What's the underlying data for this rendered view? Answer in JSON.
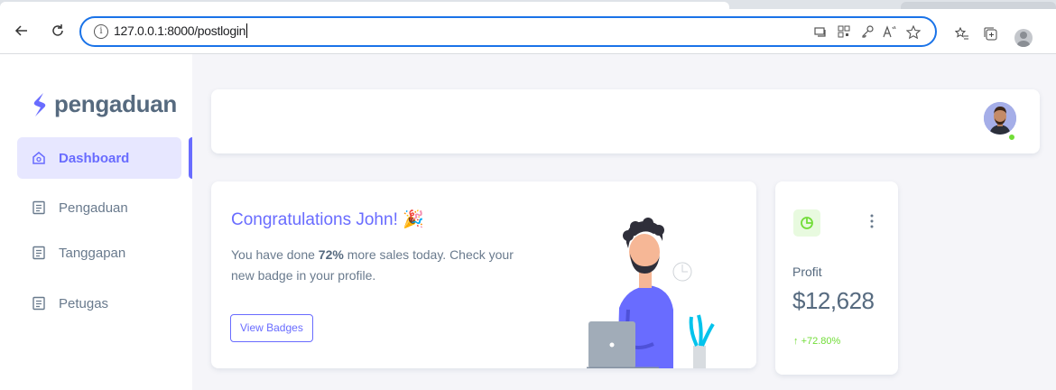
{
  "browser": {
    "url": "127.0.0.1:8000/postlogin"
  },
  "sidebar": {
    "brand": "pengaduan",
    "items": [
      {
        "label": "Dashboard",
        "active": true
      },
      {
        "label": "Pengaduan",
        "active": false
      },
      {
        "label": "Tanggapan",
        "active": false
      },
      {
        "label": "Petugas",
        "active": false
      }
    ]
  },
  "welcome": {
    "title": "Congratulations John! 🎉",
    "text_before": "You have done ",
    "text_bold": "72%",
    "text_after": " more sales today. Check your new badge in your profile.",
    "button": "View Badges"
  },
  "profit": {
    "label": "Profit",
    "value": "$12,628",
    "change": "+72.80%"
  },
  "colors": {
    "primary": "#696cff",
    "success": "#71dd37",
    "text": "#566a7f"
  }
}
